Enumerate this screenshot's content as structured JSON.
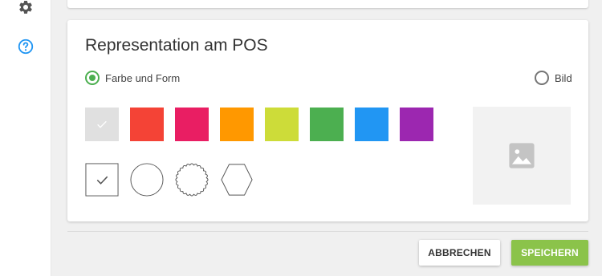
{
  "sidebar": {
    "icons": [
      {
        "name": "gear-icon",
        "color": "#555555"
      },
      {
        "name": "help-circle-icon",
        "color": "#2196f3"
      }
    ]
  },
  "card": {
    "title": "Representation am POS",
    "radios": {
      "color_shape_label": "Farbe und Form",
      "color_shape_checked": true,
      "image_label": "Bild",
      "image_checked": false
    },
    "colors": [
      {
        "hex": "#e0e0e0",
        "selected": true
      },
      {
        "hex": "#f44336",
        "selected": false
      },
      {
        "hex": "#e91e63",
        "selected": false
      },
      {
        "hex": "#ff9800",
        "selected": false
      },
      {
        "hex": "#cddc39",
        "selected": false
      },
      {
        "hex": "#4caf50",
        "selected": false
      },
      {
        "hex": "#2196f3",
        "selected": false
      },
      {
        "hex": "#9c27b0",
        "selected": false
      }
    ],
    "shapes": [
      {
        "shape": "square",
        "selected": true
      },
      {
        "shape": "circle",
        "selected": false
      },
      {
        "shape": "scalloped-circle",
        "selected": false
      },
      {
        "shape": "hexagon",
        "selected": false
      }
    ],
    "image_placeholder_icon": "image-icon"
  },
  "footer": {
    "cancel_label": "ABBRECHEN",
    "save_label": "SPEICHERN"
  },
  "colors": {
    "accent": "#4caf50",
    "save_button": "#8bc34a",
    "help_icon": "#2196f3"
  }
}
